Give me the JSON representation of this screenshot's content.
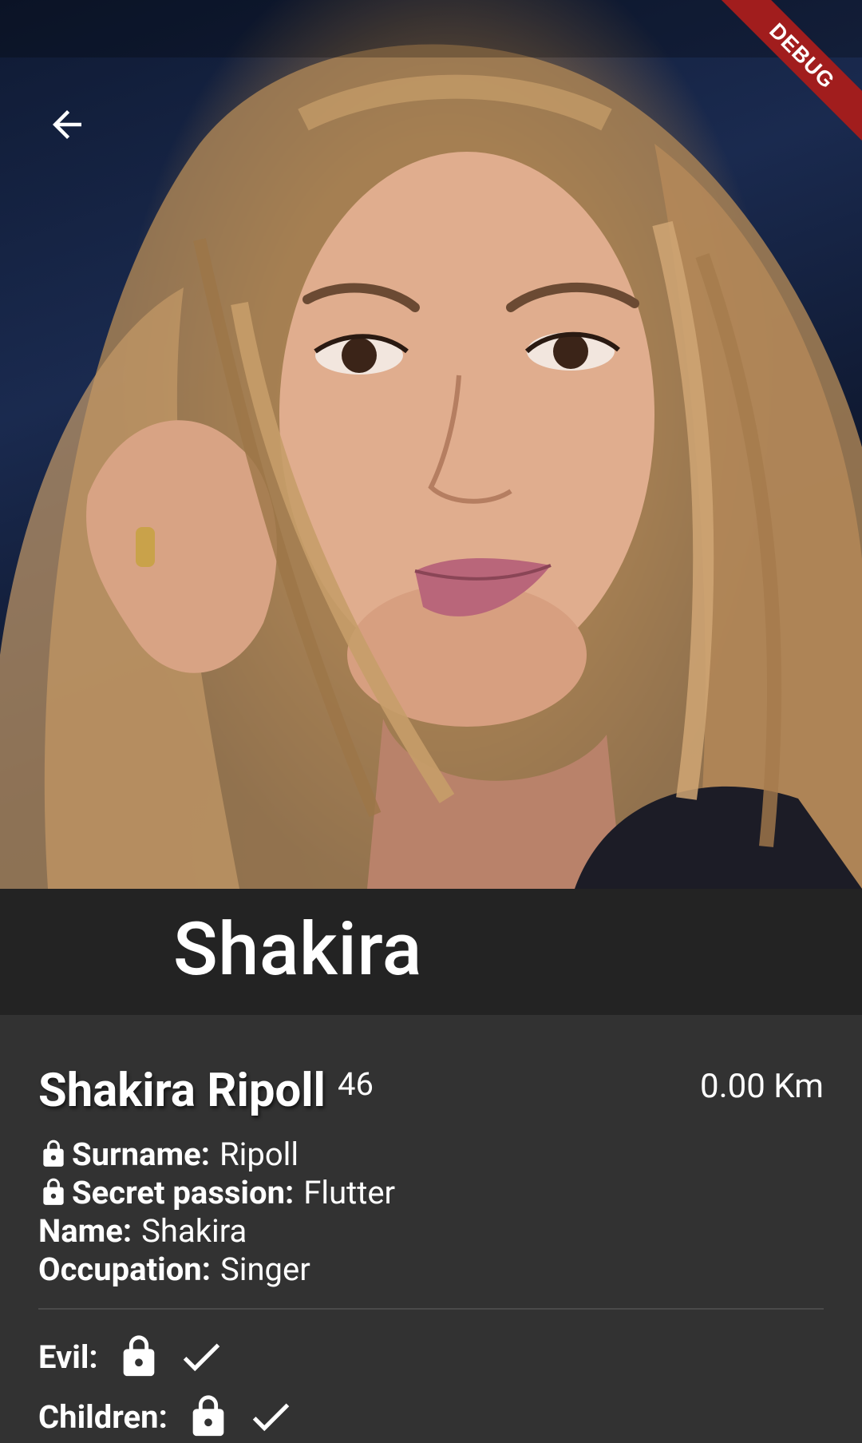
{
  "appbar": {
    "title": "Shakira",
    "debug_banner": "DEBUG"
  },
  "profile": {
    "full_name": "Shakira Ripoll",
    "age": "46",
    "distance": "0.00 Km",
    "fields": [
      {
        "label": "Surname:",
        "value": "Ripoll",
        "locked": true
      },
      {
        "label": "Secret passion:",
        "value": "Flutter",
        "locked": true
      },
      {
        "label": "Name:",
        "value": "Shakira",
        "locked": false
      },
      {
        "label": "Occupation:",
        "value": "Singer",
        "locked": false
      }
    ],
    "flags": [
      {
        "label": "Evil:",
        "locked": true,
        "checked": true
      },
      {
        "label": "Children:",
        "locked": true,
        "checked": true
      }
    ]
  },
  "colors": {
    "title_band": "#232323",
    "details_bg": "#323232",
    "debug_ribbon": "#a11d1d"
  },
  "icons": [
    "back-arrow-icon",
    "lock-icon",
    "check-icon"
  ]
}
